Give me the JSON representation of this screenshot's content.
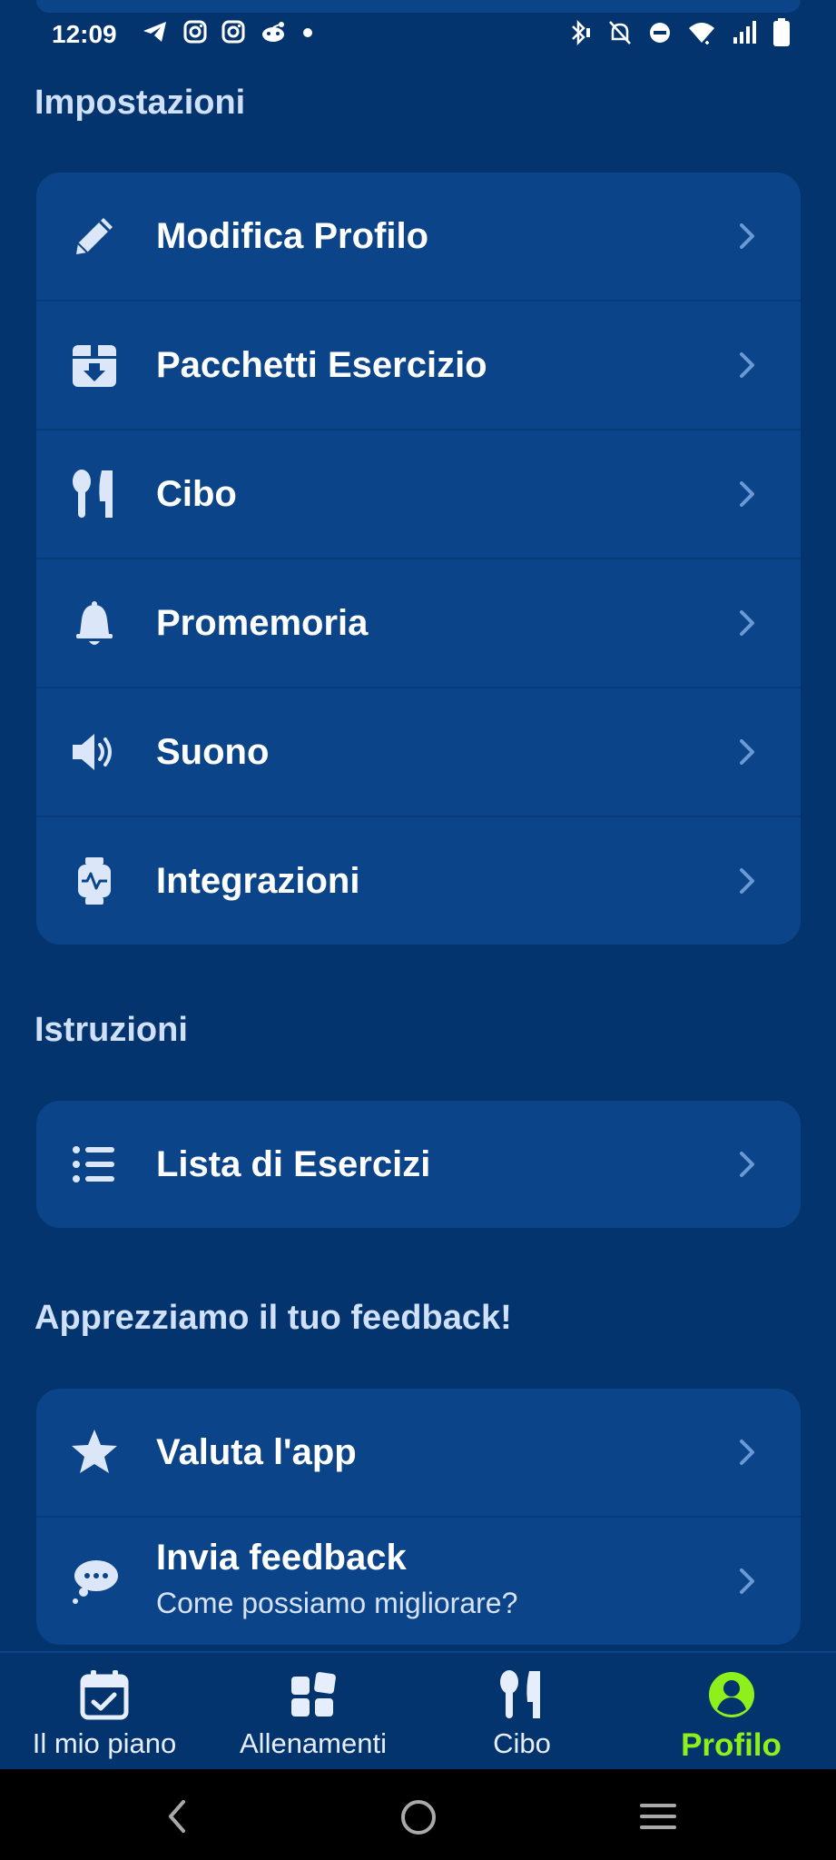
{
  "status": {
    "time": "12:09",
    "left_icons": [
      "telegram-icon",
      "instagram-icon",
      "instagram-icon",
      "reddit-icon",
      "dot-icon"
    ],
    "right_icons": [
      "bluetooth-icon",
      "mute-icon",
      "dnd-icon",
      "wifi-icon",
      "signal-icon",
      "battery-icon"
    ]
  },
  "sections": {
    "settings": {
      "title": "Impostazioni",
      "items": [
        {
          "label": "Modifica Profilo",
          "icon": "pencil-icon"
        },
        {
          "label": "Pacchetti Esercizio",
          "icon": "package-download-icon"
        },
        {
          "label": "Cibo",
          "icon": "cutlery-icon"
        },
        {
          "label": "Promemoria",
          "icon": "bell-icon"
        },
        {
          "label": "Suono",
          "icon": "speaker-icon"
        },
        {
          "label": "Integrazioni",
          "icon": "smartwatch-icon"
        }
      ]
    },
    "instructions": {
      "title": "Istruzioni",
      "items": [
        {
          "label": "Lista di Esercizi",
          "icon": "list-icon"
        }
      ]
    },
    "feedback": {
      "title": "Apprezziamo il tuo feedback!",
      "items": [
        {
          "label": "Valuta l'app",
          "icon": "star-icon"
        },
        {
          "label": "Invia feedback",
          "sublabel": "Come possiamo migliorare?",
          "icon": "chat-bubble-icon"
        }
      ]
    }
  },
  "bottom_nav": {
    "items": [
      {
        "label": "Il mio piano",
        "icon": "calendar-check-icon",
        "active": false
      },
      {
        "label": "Allenamenti",
        "icon": "grid-icon",
        "active": false
      },
      {
        "label": "Cibo",
        "icon": "cutlery-icon",
        "active": false
      },
      {
        "label": "Profilo",
        "icon": "user-circle-icon",
        "active": true
      }
    ]
  },
  "system_nav": [
    "back-icon",
    "home-icon",
    "recents-icon"
  ],
  "colors": {
    "background": "#04346e",
    "card": "#0b4488",
    "active": "#8ef01b",
    "section_title": "#cfe0f8"
  }
}
